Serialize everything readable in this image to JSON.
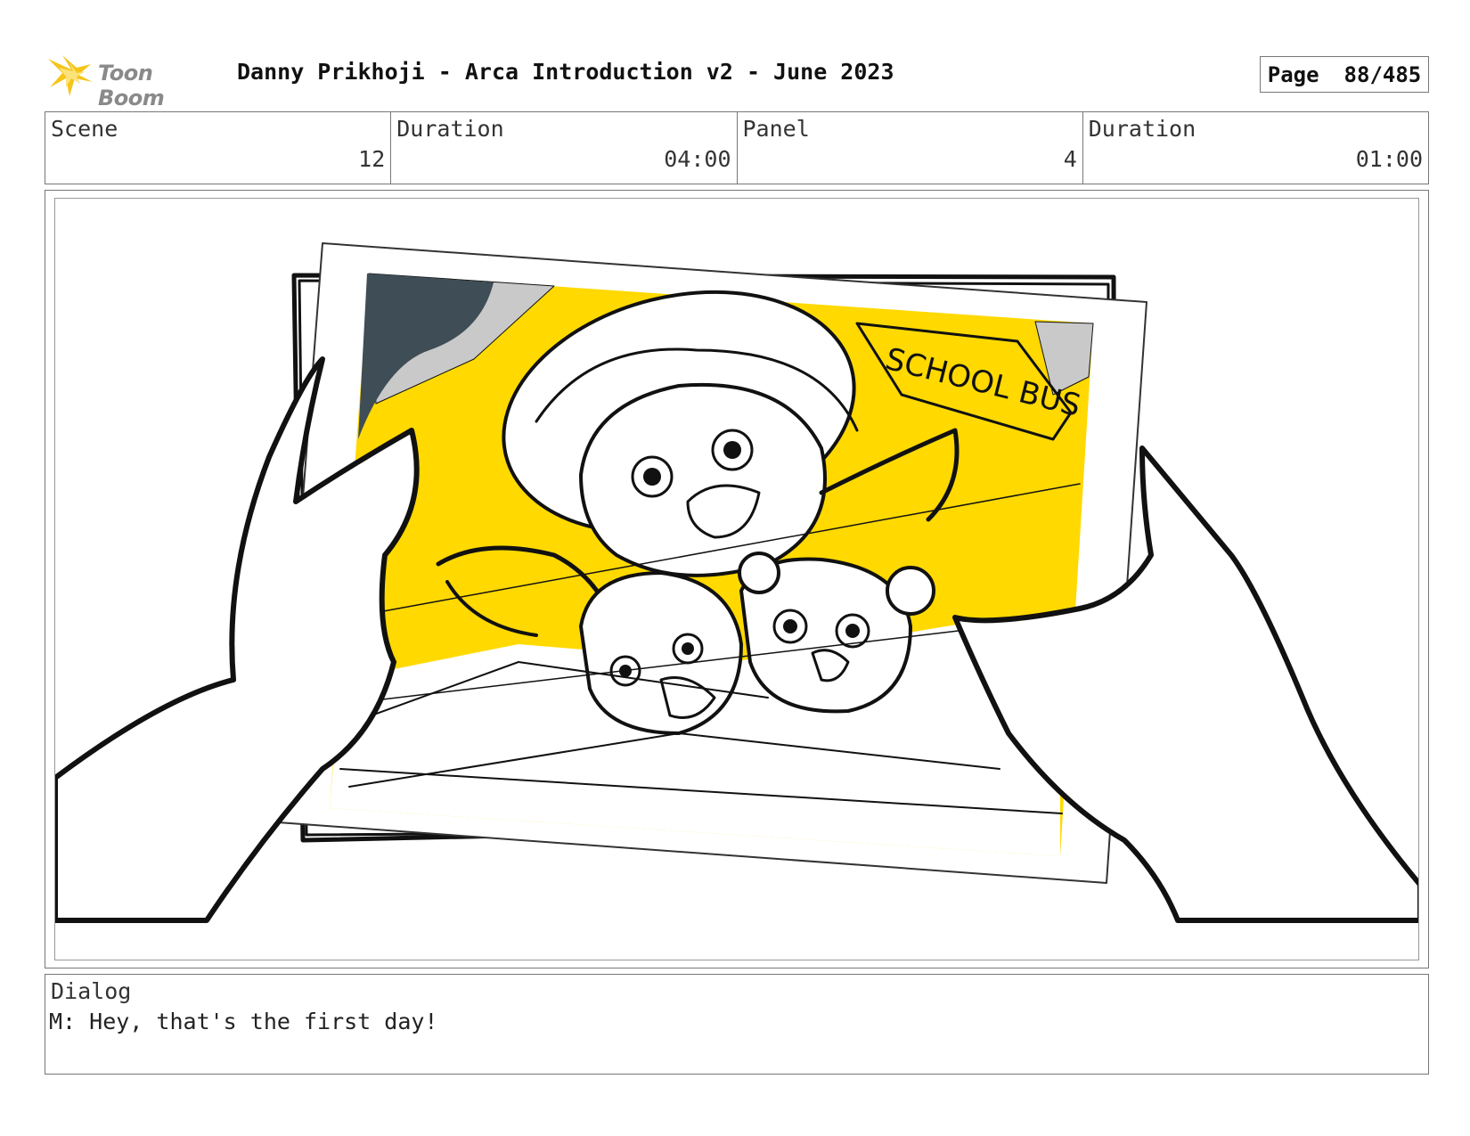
{
  "header": {
    "logo_text": "Toon Boom",
    "title": "Danny Prikhoji - Arca Introduction v2 - June 2023",
    "page_label": "Page",
    "page_number": "88/485"
  },
  "info": [
    {
      "label": "Scene",
      "value": "12"
    },
    {
      "label": "Duration",
      "value": "04:00"
    },
    {
      "label": "Panel",
      "value": "4"
    },
    {
      "label": "Duration",
      "value": "01:00"
    }
  ],
  "panel": {
    "sign_text": "SCHOOL BUS",
    "colors": {
      "yellow": "#FFD900",
      "sky": "#c9c9c9",
      "dark": "#3f4d56",
      "ink": "#111111"
    }
  },
  "dialog": {
    "label": "Dialog",
    "text": "M: Hey, that's the first day!"
  }
}
